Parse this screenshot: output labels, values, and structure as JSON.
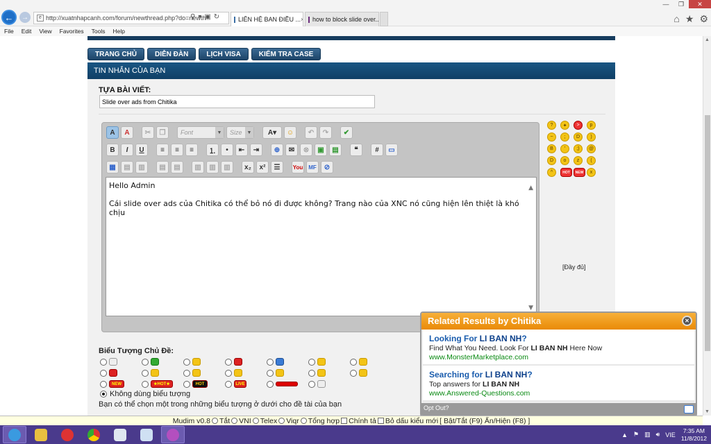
{
  "browser": {
    "address": "http://xuatnhapcanh.com/forum/newthread.php?do=newth",
    "tabs": [
      {
        "label": "LIÊN HỆ BAN ĐIỀU ..."
      },
      {
        "label": "how to block slide over..."
      }
    ],
    "menu": [
      "File",
      "Edit",
      "View",
      "Favorites",
      "Tools",
      "Help"
    ]
  },
  "nav": [
    "TRANG CHỦ",
    "DIỄN ĐÀN",
    "LỊCH VISA",
    "KIỂM TRA CASE"
  ],
  "panel": {
    "header": "TIN NHẮN CỦA BẠN",
    "title_label": "TỰA BÀI VIẾT:",
    "title_value": "Slide over ads from Chitika"
  },
  "editor": {
    "font_placeholder": "Font",
    "size_placeholder": "Size",
    "body_line1": "Hello Admin",
    "body_line2": "Cái slide over ads của Chitika có thể bỏ nó đi được không? Trang nào của XNC nó cũng hiện lên thiệt là khó chịu",
    "full_link": "[Đầy đủ]"
  },
  "icons_section": {
    "label": "Biểu Tượng Chủ Đề:",
    "no_icon": "Không dùng biểu tượng",
    "hint": "Bạn có thể chọn một trong những biểu tượng ở dưới cho đề tài của bạn"
  },
  "chitika": {
    "header": "Related Results by Chitika",
    "items": [
      {
        "title_pre": "Looking For ",
        "title_kw": "LI BAN NH",
        "title_post": "?",
        "desc_pre": "Find What You Need. Look For ",
        "desc_kw": "LI BAN NH",
        "desc_post": " Here Now",
        "url": "www.MonsterMarketplace.com"
      },
      {
        "title_pre": "Searching for ",
        "title_kw": "LI BAN NH",
        "title_post": "?",
        "desc_pre": "Top answers for ",
        "desc_kw": "LI BAN NH",
        "desc_post": "",
        "url": "www.Answered-Questions.com"
      }
    ],
    "opt_out": "Opt Out?"
  },
  "mudim": {
    "name": "Mudim v0.8",
    "options": [
      "Tắt",
      "VNI",
      "Telex",
      "Viqr",
      "Tổng hợp"
    ],
    "checks": [
      "Chính tả",
      "Bỏ dấu kiểu mới"
    ],
    "shortcut": "[ Bật/Tắt (F9) Ẩn/Hiện (F8) ]"
  },
  "taskbar": {
    "lang": "VIE",
    "time": "7:35 AM",
    "date": "11/8/2012"
  },
  "colors": {
    "panel_header": "#0f3f66",
    "chitika_orange": "#e98a06",
    "link_blue": "#1a5cad",
    "url_green": "#0a8a13",
    "taskbar": "#4a3a8c"
  }
}
